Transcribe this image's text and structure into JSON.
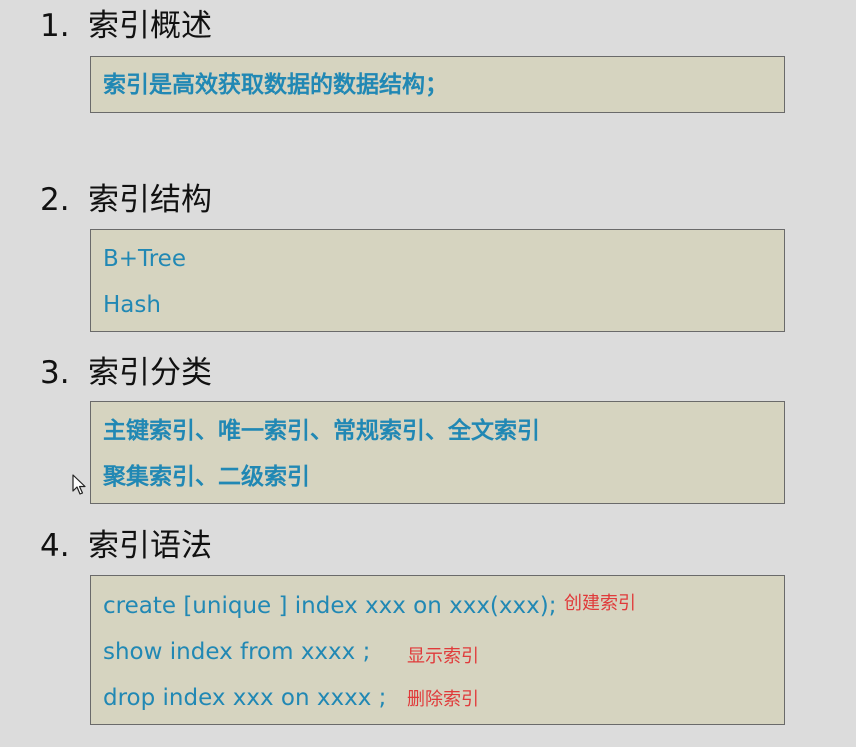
{
  "sections": [
    {
      "number": "1.",
      "title": "索引概述",
      "lines": [
        "索引是高效获取数据的数据结构；"
      ]
    },
    {
      "number": "2.",
      "title": "索引结构",
      "lines": [
        "B+Tree",
        "Hash"
      ]
    },
    {
      "number": "3.",
      "title": "索引分类",
      "lines": [
        "主键索引、唯一索引、常规索引、全文索引",
        "聚集索引、二级索引"
      ]
    },
    {
      "number": "4.",
      "title": "索引语法",
      "lines": [
        {
          "code": "create [unique ] index   xxx  on xxx(xxx);",
          "note": "创建索引"
        },
        {
          "code": "show  index  from  xxxx  ;",
          "note": "显示索引"
        },
        {
          "code": "drop  index  xxx  on xxxx ;",
          "note": "删除索引"
        }
      ]
    }
  ],
  "colors": {
    "box_bg": "#d6d4c0",
    "text_blue": "#2188b4",
    "note_red": "#e03a3a",
    "page_bg": "#dcdcdc"
  },
  "icons": {
    "cursor": "mouse-pointer-icon"
  }
}
